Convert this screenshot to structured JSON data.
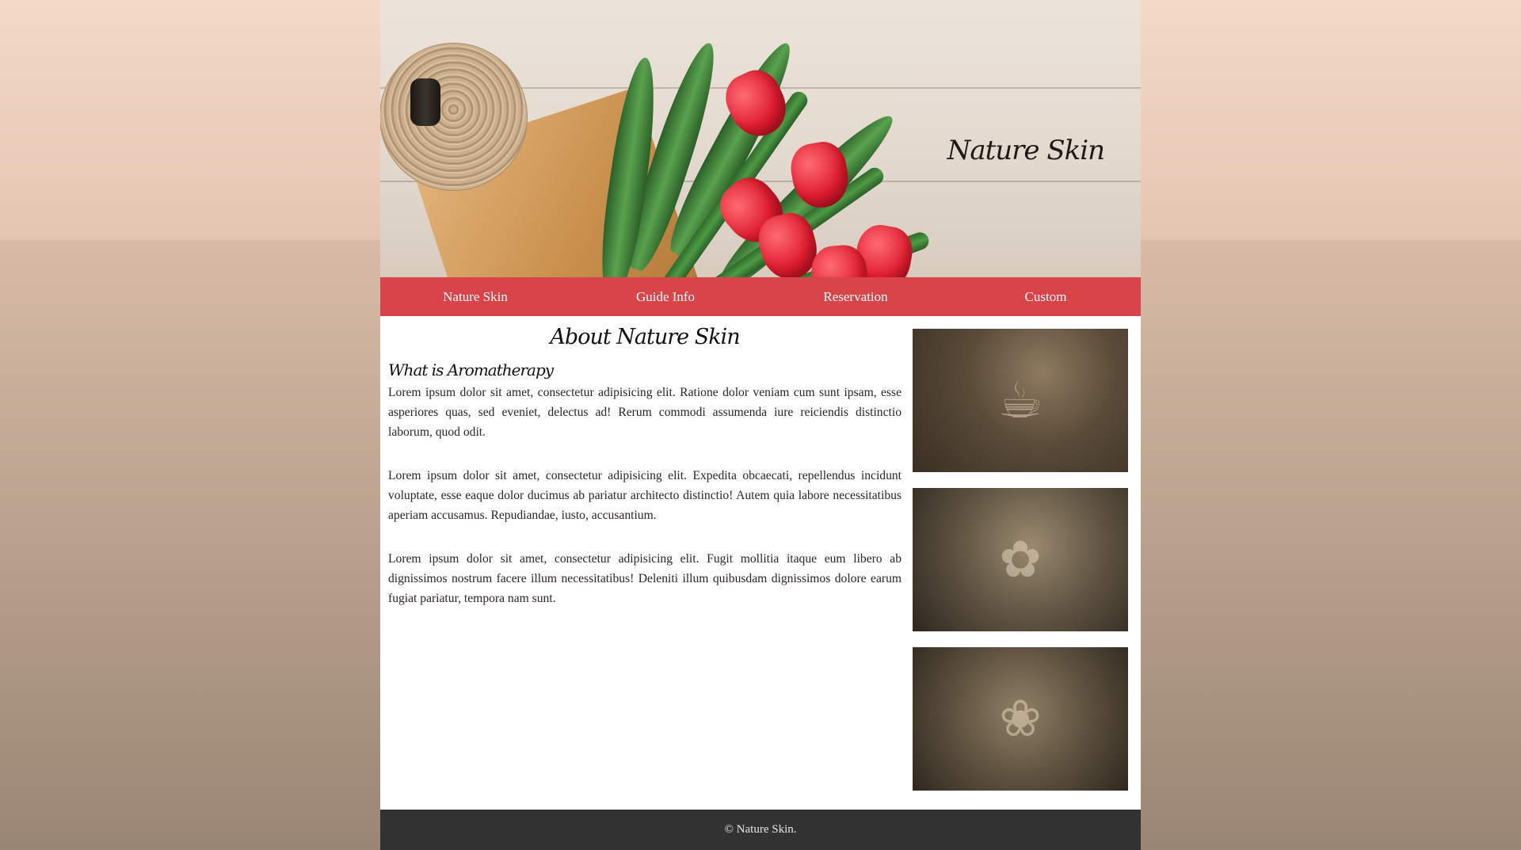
{
  "hero": {
    "site_title": "Nature Skin"
  },
  "nav": {
    "items": [
      {
        "label": "Nature Skin"
      },
      {
        "label": "Guide Info"
      },
      {
        "label": "Reservation"
      },
      {
        "label": "Custom"
      }
    ]
  },
  "main": {
    "title": "About Nature Skin",
    "subtitle": "What is Aromatherapy",
    "paragraphs": [
      "Lorem ipsum dolor sit amet, consectetur adipisicing elit. Ratione dolor veniam cum sunt ipsam, esse asperiores quas, sed eveniet, delectus ad! Rerum commodi assumenda iure reiciendis distinctio laborum, quod odit.",
      "Lorem ipsum dolor sit amet, consectetur adipisicing elit. Expedita obcaecati, repellendus incidunt voluptate, esse eaque dolor ducimus ab pariatur architecto distinctio! Autem quia labore necessitatibus aperiam accusamus. Repudiandae, iusto, accusantium.",
      "Lorem ipsum dolor sit amet, consectetur adipisicing elit. Fugit mollitia itaque eum libero ab dignissimos nostrum facere illum necessitatibus! Deleniti illum quibusdam dignissimos dolore earum fugiat pariatur, tempora nam sunt."
    ]
  },
  "sidebar": {
    "images": [
      {
        "icon": "aroma-bottle-icon"
      },
      {
        "icon": "flower-bouquet-icon"
      },
      {
        "icon": "flower-jar-icon"
      }
    ]
  },
  "footer": {
    "text": "© Nature Skin."
  },
  "colors": {
    "nav_bg": "#d6343a",
    "footer_bg": "#323232",
    "page_bg": "#ffffff"
  }
}
